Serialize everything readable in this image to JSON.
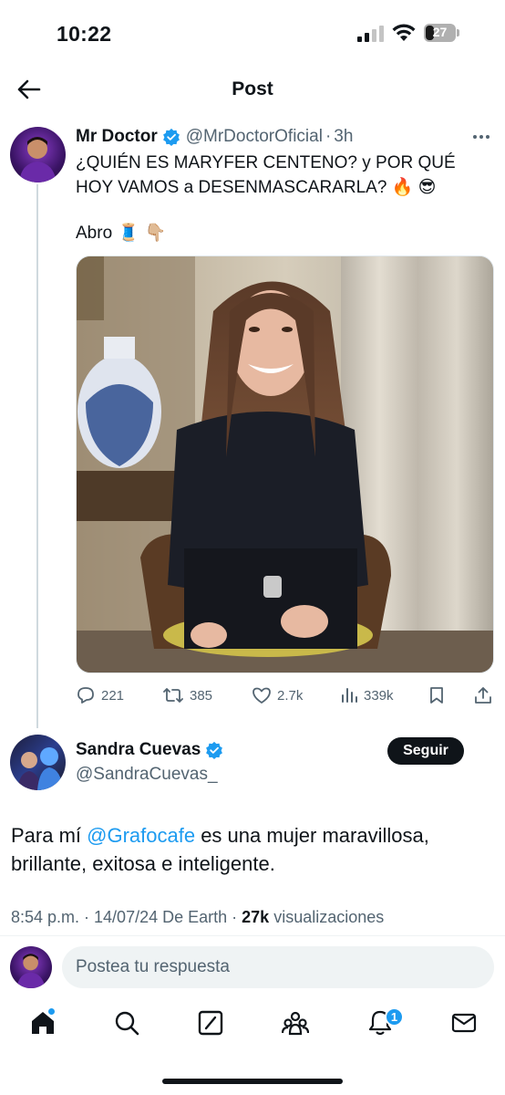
{
  "status_bar": {
    "time": "10:22",
    "battery": "27"
  },
  "header": {
    "title": "Post"
  },
  "tweet": {
    "author_name": "Mr Doctor",
    "handle": "@MrDoctorOficial",
    "separator": "·",
    "time_ago": "3h",
    "text": "¿QUIÉN ES MARYFER CENTENO? y POR QUÉ HOY VAMOS a DESENMASCARARLA? 🔥 😎",
    "text_line2": "Abro",
    "emoji_thread": "🧵",
    "emoji_point": "👇🏼",
    "stats": {
      "replies": "221",
      "reposts": "385",
      "likes": "2.7k",
      "views": "339k"
    }
  },
  "reply": {
    "author_name": "Sandra Cuevas",
    "handle": "@SandraCuevas_",
    "follow_label": "Seguir",
    "text_before": "Para mí ",
    "mention": "@Grafocafe",
    "text_after": " es una mujer maravillosa, brillante, exitosa e inteligente.",
    "meta_prefix": "8:54 p.m. · 14/07/24 De Earth · ",
    "meta_views_count": "27k",
    "meta_views_label": " visualizaciones"
  },
  "compose": {
    "placeholder": "Postea tu respuesta"
  },
  "tabbar": {
    "notifications_badge": "1",
    "icons": [
      "home-icon",
      "search-icon",
      "grok-icon",
      "communities-icon",
      "notifications-icon",
      "messages-icon"
    ]
  },
  "colors": {
    "accent": "#1d9bf0",
    "text": "#0f1419",
    "secondary": "#536471"
  }
}
